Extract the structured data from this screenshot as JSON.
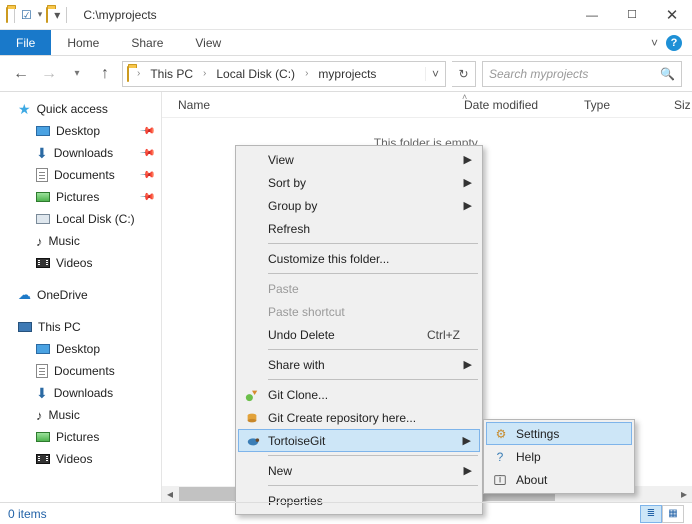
{
  "window": {
    "path": "C:\\myprojects"
  },
  "ribbon": {
    "file": "File",
    "home": "Home",
    "share": "Share",
    "view": "View"
  },
  "address": {
    "crumbs": [
      "This PC",
      "Local Disk (C:)",
      "myprojects"
    ],
    "search_placeholder": "Search myprojects"
  },
  "columns": {
    "name": "Name",
    "date": "Date modified",
    "type": "Type",
    "size": "Siz"
  },
  "empty_text": "This folder is empty.",
  "nav": {
    "quick": "Quick access",
    "desktop": "Desktop",
    "downloads": "Downloads",
    "documents": "Documents",
    "pictures": "Pictures",
    "localdisk": "Local Disk (C:)",
    "music": "Music",
    "videos": "Videos",
    "onedrive": "OneDrive",
    "thispc": "This PC",
    "desktop2": "Desktop",
    "documents2": "Documents",
    "downloads2": "Downloads",
    "music2": "Music",
    "pictures2": "Pictures",
    "videos2": "Videos"
  },
  "ctx": {
    "view": "View",
    "sortby": "Sort by",
    "groupby": "Group by",
    "refresh": "Refresh",
    "customize": "Customize this folder...",
    "paste": "Paste",
    "pastesc": "Paste shortcut",
    "undodel": "Undo Delete",
    "undodel_sc": "Ctrl+Z",
    "sharewith": "Share with",
    "gitclone": "Git Clone...",
    "gitcreate": "Git Create repository here...",
    "tortoise": "TortoiseGit",
    "new": "New",
    "properties": "Properties"
  },
  "sub": {
    "settings": "Settings",
    "help": "Help",
    "about": "About"
  },
  "status": {
    "items": "0 items"
  }
}
